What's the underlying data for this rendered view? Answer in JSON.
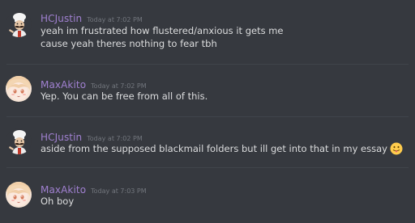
{
  "messages": [
    {
      "username": "HCJustin",
      "timestamp": "Today at 7:02 PM",
      "username_color": "#a080d0",
      "avatar_icon": "chef-avatar-icon",
      "lines": [
        "yeah im frustrated how flustered/anxious it gets me",
        "cause yeah theres nothing to fear tbh"
      ]
    },
    {
      "username": "MaxAkito",
      "timestamp": "Today at 7:02 PM",
      "username_color": "#a080d0",
      "avatar_icon": "anime-girl-avatar-icon",
      "lines": [
        "Yep. You can be free from all of this."
      ]
    },
    {
      "username": "HCJustin",
      "timestamp": "Today at 7:02 PM",
      "username_color": "#a080d0",
      "avatar_icon": "chef-avatar-icon",
      "lines": [
        "aside from the supposed blackmail folders but ill get into that in my essay"
      ],
      "trailing_emoji": "tongue-out-emoji-icon"
    },
    {
      "username": "MaxAkito",
      "timestamp": "Today at 7:03 PM",
      "username_color": "#a080d0",
      "avatar_icon": "anime-girl-avatar-icon",
      "lines": [
        "Oh boy"
      ]
    }
  ],
  "colors": {
    "background": "#36393f",
    "divider": "#40444b",
    "text": "#dcddde",
    "timestamp": "#72767d",
    "username": "#a080d0"
  }
}
